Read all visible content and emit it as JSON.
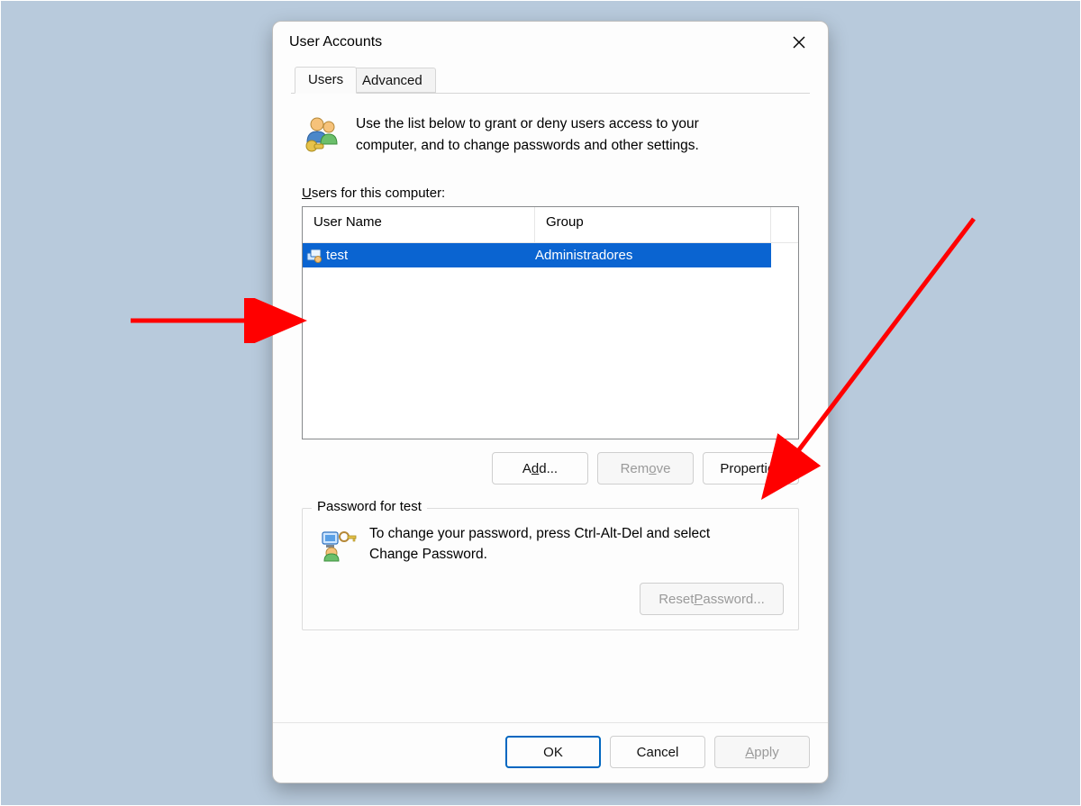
{
  "window": {
    "title": "User Accounts"
  },
  "tabs": {
    "users": "Users",
    "advanced": "Advanced"
  },
  "intro": {
    "text": "Use the list below to grant or deny users access to your computer, and to change passwords and other settings."
  },
  "users_section": {
    "label_pre": "U",
    "label_rest": "sers for this computer:",
    "columns": {
      "username": "User Name",
      "group": "Group"
    },
    "rows": [
      {
        "username": "test",
        "group": "Administradores",
        "selected": true
      }
    ]
  },
  "buttons": {
    "add_pre": "A",
    "add_mid": "d",
    "add_post": "d...",
    "remove_pre": "Rem",
    "remove_mid": "o",
    "remove_post": "ve",
    "properties": "Properties",
    "ok": "OK",
    "cancel": "Cancel",
    "apply_pre": "A",
    "apply_rest": "pply",
    "reset_pre": "Reset ",
    "reset_mid": "P",
    "reset_post": "assword..."
  },
  "password_section": {
    "legend": "Password for test",
    "text": "To change your password, press Ctrl-Alt-Del and select Change Password."
  },
  "colors": {
    "selection": "#0a64d1",
    "arrow": "#ff0000",
    "backdrop": "#b8cadc"
  }
}
